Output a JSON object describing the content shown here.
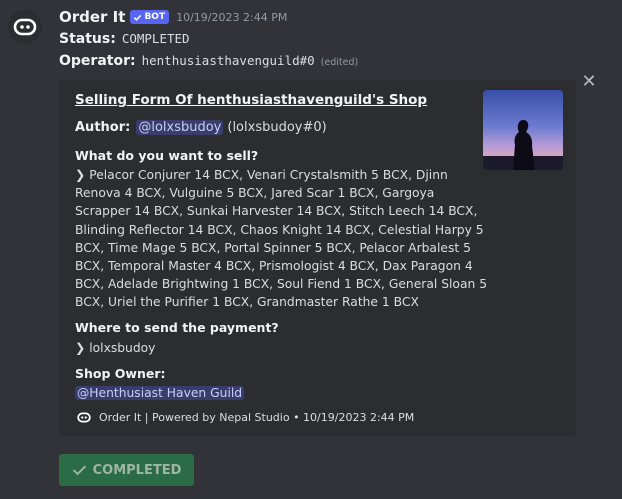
{
  "message": {
    "author": "Order It",
    "badge": "BOT",
    "timestamp": "10/19/2023 2:44 PM",
    "status_label": "Status:",
    "status_value": "COMPLETED",
    "operator_label": "Operator:",
    "operator_value": "henthusiasthavenguild#0",
    "edited": "(edited)"
  },
  "embed": {
    "title": "Selling Form Of henthusiasthavenguild's Shop",
    "author_label": "Author:",
    "author_mention": "@lolxsbudoy",
    "author_tag": "(lolxsbudoy#0)",
    "fields": [
      {
        "name": "What do you want to sell?",
        "lines": [
          "❯ Pelacor Conjurer 14 BCX, Venari Crystalsmith 5 BCX, Djinn",
          "Renova 4 BCX, Vulguine 5 BCX, Jared Scar 1 BCX, Gargoya",
          "Scrapper 14 BCX, Sunkai Harvester 14 BCX, Stitch Leech 14 BCX,",
          "Blinding Reflector 14 BCX, Chaos Knight 14 BCX, Celestial Harpy 5",
          "BCX, Time Mage 5 BCX, Portal Spinner 5 BCX, Pelacor Arbalest 5",
          "BCX, Temporal Master 4 BCX, Prismologist 4 BCX, Dax Paragon 4",
          "BCX, Adelade Brightwing 1 BCX, Soul Fiend 1 BCX, General Sloan 5",
          "BCX, Uriel the Purifier 1 BCX, Grandmaster Rathe 1 BCX"
        ]
      },
      {
        "name": "Where to send the payment?",
        "lines": [
          "❯ lolxsbudoy"
        ]
      },
      {
        "name": "Shop Owner:",
        "mention": "@Henthusiast Haven Guild"
      }
    ],
    "footer": "Order It | Powered by Nepal Studio • 10/19/2023 2:44 PM"
  },
  "button": {
    "label": "COMPLETED"
  },
  "colors": {
    "background": "#313338",
    "embed": "#2b2d31",
    "blurple": "#5865f2",
    "success_button": "#2b6b45"
  }
}
